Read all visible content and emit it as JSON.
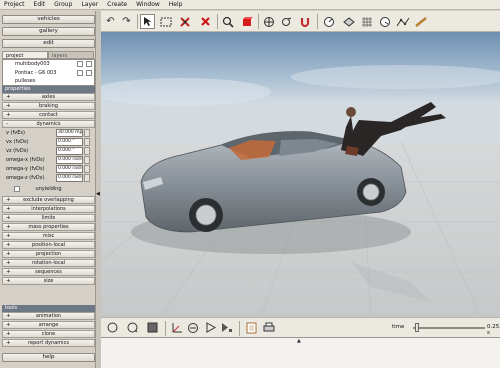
{
  "menubar": [
    "Project",
    "Edit",
    "Group",
    "Layer",
    "Create",
    "Window",
    "Help"
  ],
  "left": {
    "top_buttons": [
      "vehicles",
      "gallery",
      "edit"
    ],
    "tabs": [
      "project",
      "layers"
    ],
    "project_items": [
      "multibody003",
      "Pontiac - G6 003",
      "pulleses"
    ],
    "properties_header": "properties",
    "sections_top": [
      "axles",
      "braking",
      "contact",
      "dynamics"
    ],
    "dynamics_fields": [
      {
        "label": "v (fvEs)",
        "value": "30.000 mph"
      },
      {
        "label": "vx (fvDs)",
        "value": "0.000 °"
      },
      {
        "label": "vz (fvDs)",
        "value": "0.000 °"
      },
      {
        "label": "omega-x (fvDs)",
        "value": "0.000 rad/s"
      },
      {
        "label": "omega-y (fvDs)",
        "value": "0.000 rad/s"
      },
      {
        "label": "omega-z (fvDs)",
        "value": "0.000 rad/s"
      }
    ],
    "unyielding": "unyielding",
    "sections_bottom": [
      "exclude overlapping",
      "interpolations",
      "limits",
      "mass properties",
      "misc",
      "position-local",
      "projection",
      "rotation-local",
      "sequences",
      "size"
    ],
    "tools_header": "tools",
    "tools": [
      "animation",
      "arrange",
      "clone",
      "report dynamics"
    ],
    "help": "help"
  },
  "timebar": {
    "label": "time",
    "value": "0.253 s",
    "position": 0.03
  },
  "colors": {
    "accent": "#6e7784",
    "sky_top": "#7f9bb8",
    "car_body": "#8f979e"
  }
}
